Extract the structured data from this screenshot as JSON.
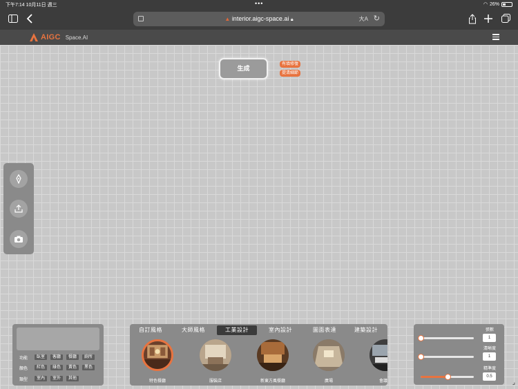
{
  "status": {
    "time": "下午7:14  10月11日 週三",
    "dots": "•••",
    "battery": "26%"
  },
  "browser": {
    "url": "interior.aigc-space.ai",
    "text_size": "大A"
  },
  "app": {
    "brand": "AIGC",
    "brand_sub": "Space.AI",
    "accent": "#e8733f"
  },
  "canvas": {
    "generate_label": "生成",
    "pill_1": "有填修復",
    "pill_2": "提清細節"
  },
  "palette": {
    "tools": [
      "pen-icon",
      "upload-icon",
      "camera-icon"
    ]
  },
  "filters": {
    "rows": [
      {
        "label": "功能",
        "chips": [
          "臥室",
          "客廳",
          "餐廳",
          "廁所"
        ]
      },
      {
        "label": "顏色",
        "chips": [
          "紅色",
          "綠色",
          "黃色",
          "黑色"
        ]
      },
      {
        "label": "類型",
        "chips": [
          "室內",
          "室外",
          "其他"
        ]
      }
    ]
  },
  "gallery": {
    "tabs": [
      "自訂風格",
      "大師風格",
      "工業設計",
      "室內設計",
      "圖面表達",
      "建築設計"
    ],
    "active_tab": "工業設計",
    "items": [
      {
        "caption": "特色餐廳"
      },
      {
        "caption": "服裝店"
      },
      {
        "caption": "新東方風餐廳"
      },
      {
        "caption": "廣場"
      },
      {
        "caption": "會議"
      }
    ]
  },
  "sliders": {
    "s1_label": "張數",
    "s1_value": "1",
    "s1_level": 0.0,
    "s2_label": "清晰度",
    "s2_value": "1",
    "s2_level": 0.0,
    "s3_label": "精準度",
    "s3_value": "0.5",
    "s3_level": 0.5
  }
}
